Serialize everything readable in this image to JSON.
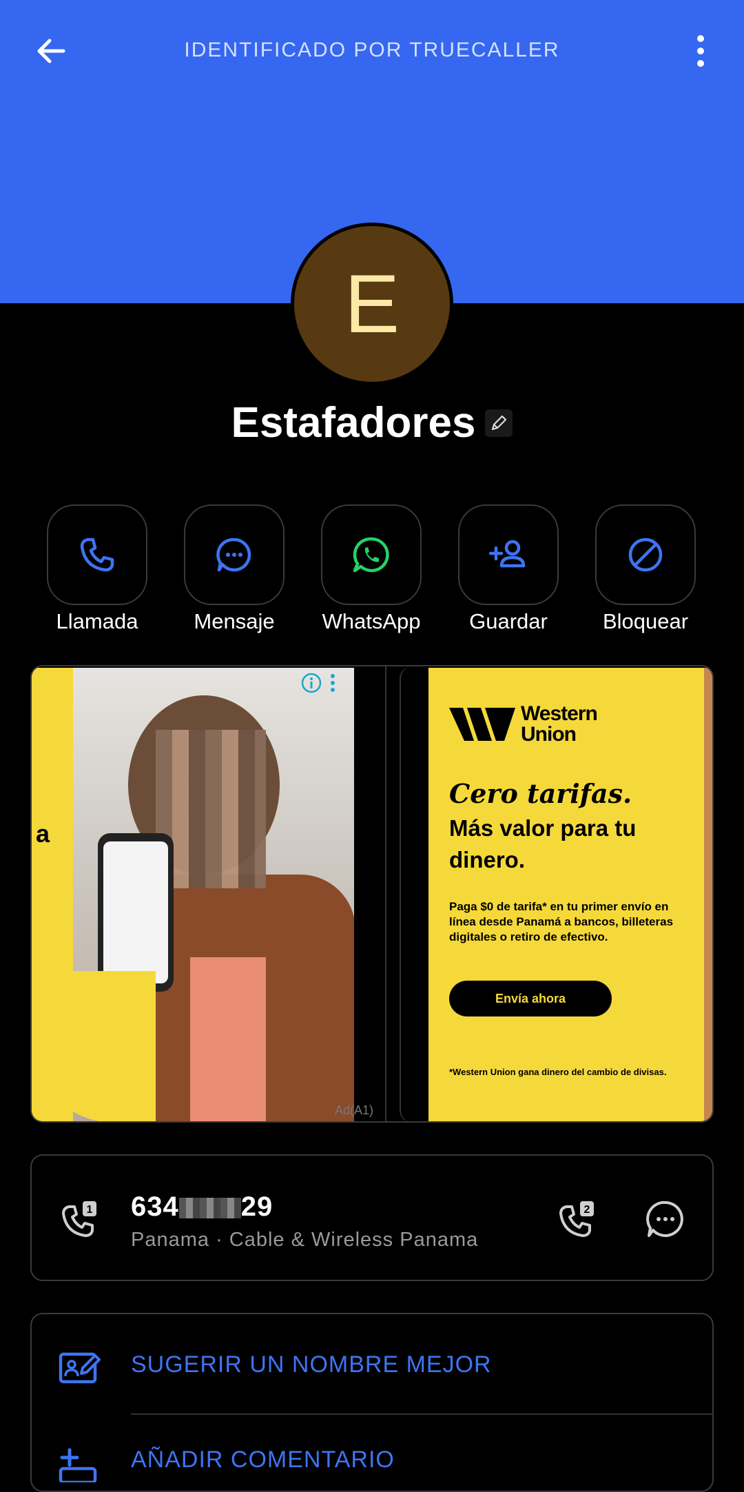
{
  "header": {
    "title": "IDENTIFICADO POR TRUECALLER",
    "back_icon": "arrow-left-icon",
    "more_icon": "more-vertical-icon",
    "background_color": "#3567F0"
  },
  "contact": {
    "avatar_letter": "E",
    "name": "Estafadores"
  },
  "actions": [
    {
      "label": "Llamada",
      "icon": "phone-icon",
      "color": "#3E74F2"
    },
    {
      "label": "Mensaje",
      "icon": "message-icon",
      "color": "#3E74F2"
    },
    {
      "label": "WhatsApp",
      "icon": "whatsapp-icon",
      "color": "#25D366"
    },
    {
      "label": "Guardar",
      "icon": "add-person-icon",
      "color": "#3E74F2"
    },
    {
      "label": "Bloquear",
      "icon": "block-icon",
      "color": "#3E74F2"
    }
  ],
  "ad": {
    "left_text": "a",
    "ad_label": "Ad(A1)",
    "brand": "Western Union",
    "brand_line1": "Western",
    "brand_line2": "Union",
    "headline1": "Cero tarifas.",
    "headline2": "Más valor para tu dinero.",
    "body": "Paga $0 de tarifa* en tu primer envío en línea desde Panamá a bancos, billeteras digitales o retiro de efectivo.",
    "cta": "Envía ahora",
    "footnote": "*Western Union gana dinero del cambio de divisas."
  },
  "phone": {
    "number_prefix": "634",
    "number_suffix": "29",
    "carrier": "Panama · Cable & Wireless Panama",
    "sim1_icon": "phone-sim1-icon",
    "sim2_icon": "phone-sim2-icon",
    "message_icon": "message-icon"
  },
  "options": {
    "suggest": "SUGERIR UN NOMBRE MEJOR",
    "comment": "AÑADIR COMENTARIO"
  }
}
